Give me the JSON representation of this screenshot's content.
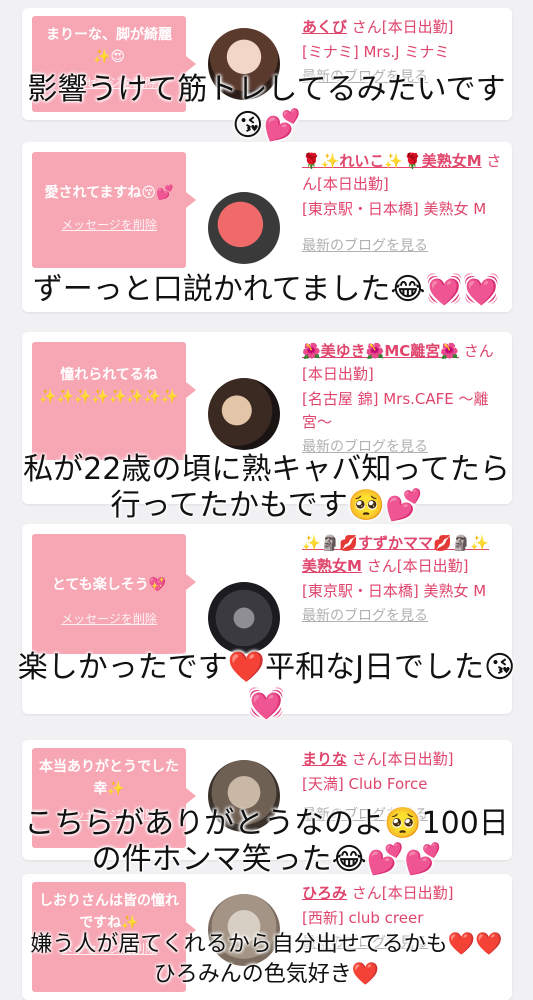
{
  "colors": {
    "background": "#f1f1f3",
    "bubble": "#f7a6b4",
    "accent": "#e0456c",
    "link_gray": "#b0b0b0"
  },
  "cards": [
    {
      "message": "まりーな、脚が綺麗✨😍",
      "delete_label": "メッセージを削除",
      "name": "あくび",
      "status": "さん[本日出勤]",
      "shop": "[ミナミ] Mrs.J ミナミ",
      "blog_label": "最新のブログを見る"
    },
    {
      "message": "愛されてますね😚💕",
      "delete_label": "メッセージを削除",
      "name": "🌹✨れいこ✨🌹美熟女M",
      "status": "さん[本日出勤]",
      "shop": "[東京駅・日本橋] 美熟女 M",
      "blog_label": "最新のブログを見る"
    },
    {
      "message": "憧れられてるね✨✨✨✨✨✨✨✨",
      "delete_label": "メッセージを削除",
      "name": "🌺美ゆき🌺MC離宮🌺",
      "status": "さん[本日出勤]",
      "shop": "[名古屋 錦] Mrs.CAFE ～離宮～",
      "blog_label": "最新のブログを見る"
    },
    {
      "message": "とても楽しそう💖",
      "delete_label": "メッセージを削除",
      "name": "✨🗿💋すずかママ💋🗿✨美熟女M",
      "status": "さん[本日出勤]",
      "shop": "[東京駅・日本橋] 美熟女 M",
      "blog_label": "最新のブログを見る"
    },
    {
      "message": "本当ありがとうでした幸✨",
      "delete_label": "メッセージを削除",
      "name": "まりな",
      "status": "さん[本日出勤]",
      "shop": "[天満] Club Force",
      "blog_label": "最新のブログを見る"
    },
    {
      "message": "しおりさんは皆の憧れですね✨",
      "delete_label": "メッセージを削除",
      "name": "ひろみ",
      "status": "さん[本日出勤]",
      "shop": "[西新] club creer",
      "blog_label": "最新のブログを見る"
    }
  ],
  "captions": [
    "影響うけて筋トレしてるみたいです😘💕",
    "ずーっと口説かれてました😂💓💓",
    "私が22歳の頃に熟キャバ知ってたら行ってたかもです🥺💕",
    "楽しかったです❤️平和なJ日でした😘💓",
    "こちらがありがとうなのよ🥺100日の件ホンマ笑った😂💕💕",
    "嫌う人が居てくれるから自分出せてるかも❤️❤️ひろみんの色気好き❤️"
  ]
}
